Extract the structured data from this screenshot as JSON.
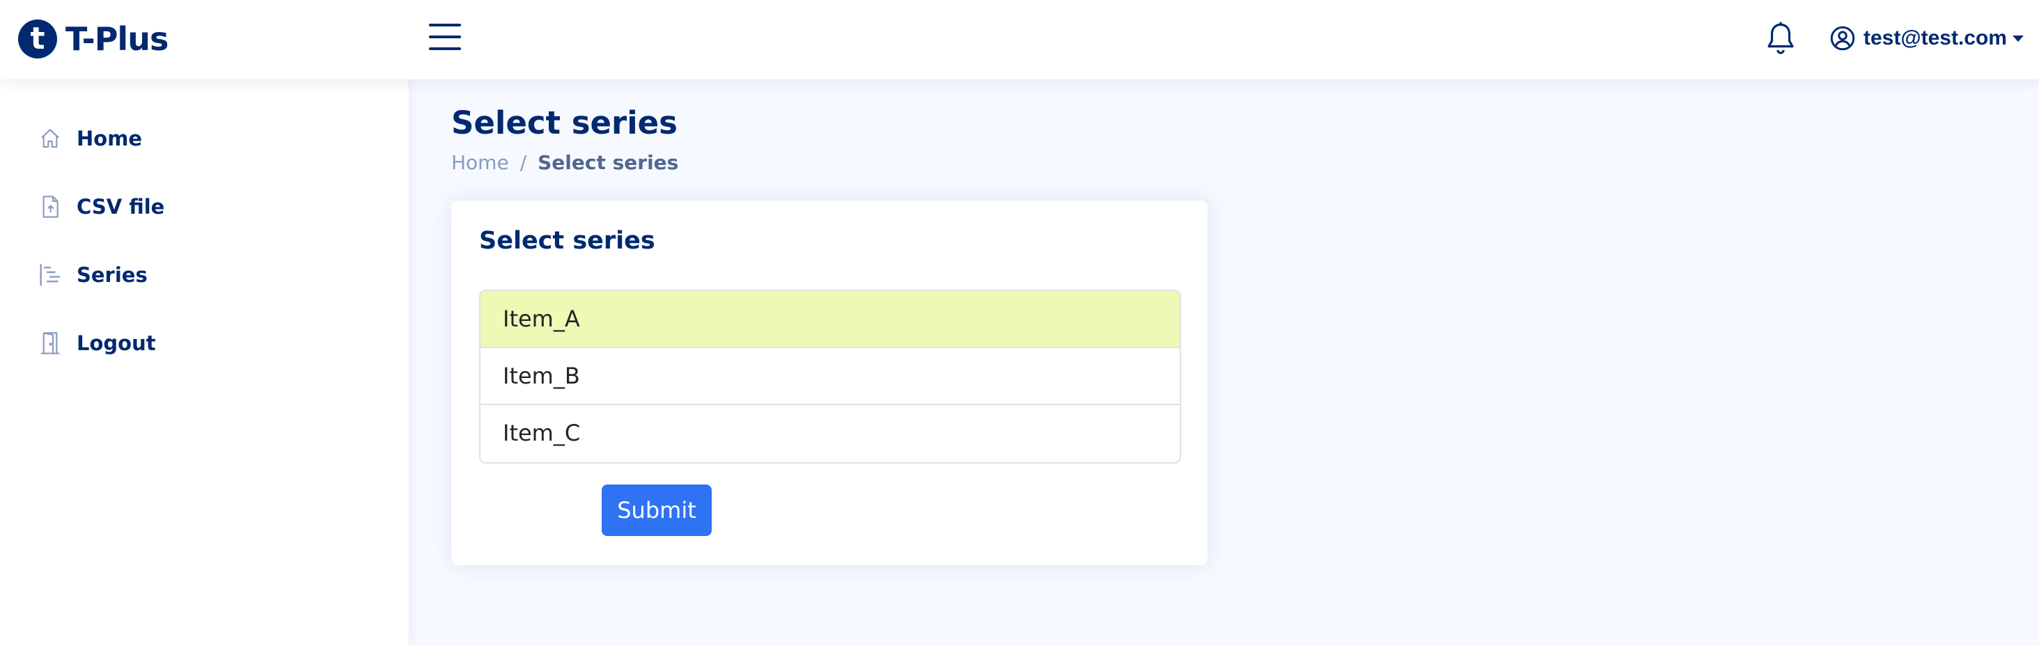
{
  "brand": {
    "name": "T-Plus",
    "logo_letter": "t"
  },
  "header": {
    "menu_icon": "hamburger-menu-icon",
    "notifications_icon": "bell-icon",
    "user": {
      "icon": "person-circle-icon",
      "email": "test@test.com"
    }
  },
  "sidebar": {
    "items": [
      {
        "label": "Home",
        "icon": "house-icon"
      },
      {
        "label": "CSV file",
        "icon": "file-upload-icon"
      },
      {
        "label": "Series",
        "icon": "list-nested-icon"
      },
      {
        "label": "Logout",
        "icon": "door-icon"
      }
    ]
  },
  "page": {
    "title": "Select series",
    "breadcrumb": {
      "home": "Home",
      "separator": "/",
      "current": "Select series"
    }
  },
  "card": {
    "title": "Select series",
    "items": [
      {
        "label": "Item_A",
        "selected": true
      },
      {
        "label": "Item_B",
        "selected": false
      },
      {
        "label": "Item_C",
        "selected": false
      }
    ],
    "submit_label": "Submit"
  },
  "colors": {
    "primary": "#012970",
    "button": "#2f73f5",
    "selected_row": "#eff8b5",
    "background": "#f6f9ff"
  }
}
